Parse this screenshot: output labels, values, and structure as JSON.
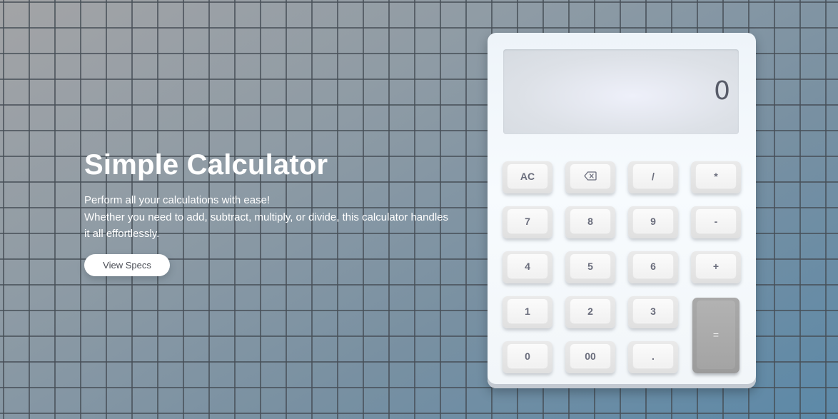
{
  "hero": {
    "title": "Simple Calculator",
    "line1": "Perform all your calculations with ease!",
    "line2": "Whether you need to add, subtract, multiply, or divide, this calculator handles it all effortlessly.",
    "button_label": "View Specs"
  },
  "calculator": {
    "display": "0",
    "keys": {
      "clear": "AC",
      "backspace": "backspace-icon",
      "divide": "/",
      "multiply": "*",
      "seven": "7",
      "eight": "8",
      "nine": "9",
      "subtract": "-",
      "four": "4",
      "five": "5",
      "six": "6",
      "add": "+",
      "one": "1",
      "two": "2",
      "three": "3",
      "equals": "=",
      "zero": "0",
      "double_zero": "00",
      "decimal": "."
    }
  }
}
